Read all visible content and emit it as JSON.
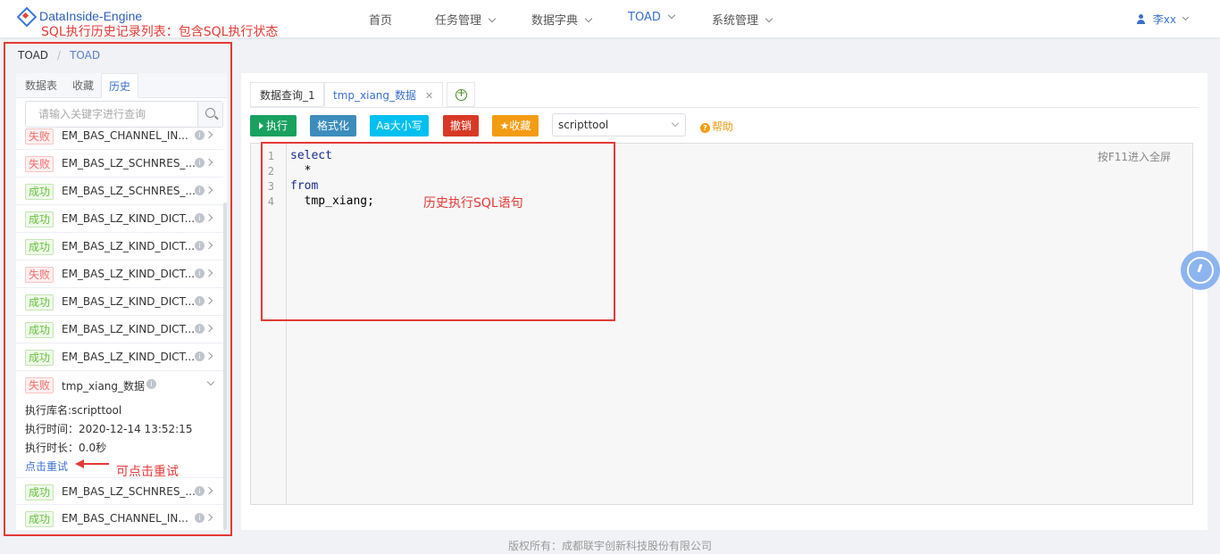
{
  "app": {
    "title": "DataInside-Engine"
  },
  "nav": {
    "items": [
      {
        "label": "首页",
        "has_dropdown": false,
        "active": false
      },
      {
        "label": "任务管理",
        "has_dropdown": true,
        "active": false
      },
      {
        "label": "数据字典",
        "has_dropdown": true,
        "active": false
      },
      {
        "label": "TOAD",
        "has_dropdown": true,
        "active": true
      },
      {
        "label": "系统管理",
        "has_dropdown": true,
        "active": false
      }
    ]
  },
  "user": {
    "name": "李xx"
  },
  "breadcrumb": [
    "TOAD",
    "TOAD"
  ],
  "annotations": {
    "history_list": "SQL执行历史记录列表：包含SQL执行状态",
    "history_sql": "历史执行SQL语句",
    "retry_hint": "可点击重试"
  },
  "left_tabs": [
    {
      "label": "数据表",
      "active": false
    },
    {
      "label": "收藏",
      "active": false
    },
    {
      "label": "历史",
      "active": true
    }
  ],
  "search": {
    "placeholder": "请输入关键字进行查询"
  },
  "history": [
    {
      "status": "失败",
      "status_type": "fail",
      "name": "EM_BAS_CHANNEL_IN..."
    },
    {
      "status": "失败",
      "status_type": "fail",
      "name": "EM_BAS_LZ_SCHNRES_..."
    },
    {
      "status": "成功",
      "status_type": "ok",
      "name": "EM_BAS_LZ_SCHNRES_..."
    },
    {
      "status": "成功",
      "status_type": "ok",
      "name": "EM_BAS_LZ_KIND_DICT..."
    },
    {
      "status": "成功",
      "status_type": "ok",
      "name": "EM_BAS_LZ_KIND_DICT..."
    },
    {
      "status": "失败",
      "status_type": "fail",
      "name": "EM_BAS_LZ_KIND_DICT..."
    },
    {
      "status": "成功",
      "status_type": "ok",
      "name": "EM_BAS_LZ_KIND_DICT..."
    },
    {
      "status": "成功",
      "status_type": "ok",
      "name": "EM_BAS_LZ_KIND_DICT..."
    },
    {
      "status": "成功",
      "status_type": "ok",
      "name": "EM_BAS_LZ_KIND_DICT..."
    },
    {
      "status": "失败",
      "status_type": "fail",
      "name": "tmp_xiang_数据",
      "expanded": true
    },
    {
      "status": "成功",
      "status_type": "ok",
      "name": "EM_BAS_LZ_SCHNRES_..."
    },
    {
      "status": "成功",
      "status_type": "ok",
      "name": "EM_BAS_CHANNEL_IN..."
    }
  ],
  "expanded_detail": {
    "db": "执行库名:scripttool",
    "time": "执行时间：2020-12-14 13:52:15",
    "duration": "执行时长：0.0秒",
    "retry": "点击重试"
  },
  "editor_tabs": [
    {
      "label": "数据查询_1",
      "active": false,
      "closable": false
    },
    {
      "label": "tmp_xiang_数据",
      "active": true,
      "closable": true
    }
  ],
  "toolbar": {
    "run": "执行",
    "format": "格式化",
    "case": "Aa大小写",
    "undo": "撤销",
    "favorite": "★收藏",
    "datasource": "scripttool",
    "help": "帮助"
  },
  "editor": {
    "fullscreen_hint": "按F11进入全屏",
    "lines": [
      {
        "no": "1",
        "text": "select",
        "kw": true
      },
      {
        "no": "2",
        "text": "  *",
        "kw": false
      },
      {
        "no": "3",
        "text": "from",
        "kw": true
      },
      {
        "no": "4",
        "text": "  tmp_xiang;",
        "kw": false
      }
    ]
  },
  "footer": "版权所有：成都联宇创新科技股份有限公司",
  "colors": {
    "primary": "#3a6fd0",
    "annotation_red": "#e53935",
    "fail": "#f56c6c",
    "ok": "#67c23a",
    "run_green": "#19a15f",
    "format_blue": "#3c8dbc",
    "case_cyan": "#00c0ef",
    "undo_red": "#d73925",
    "favorite_orange": "#f39c12"
  }
}
